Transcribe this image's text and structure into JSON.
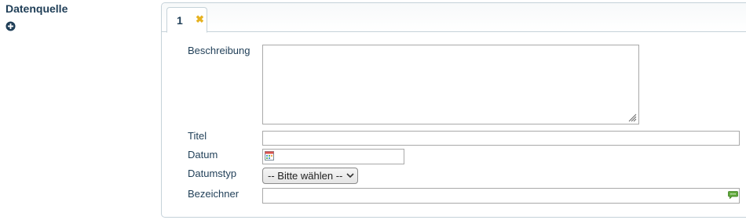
{
  "section": {
    "label": "Datenquelle",
    "add_icon": "plus-circle-icon"
  },
  "tabs": [
    {
      "label": "1",
      "close_icon": "close-x-icon",
      "close_glyph": "✖"
    }
  ],
  "form": {
    "beschreibung": {
      "label": "Beschreibung",
      "value": ""
    },
    "titel": {
      "label": "Titel",
      "value": ""
    },
    "datum": {
      "label": "Datum",
      "value": "",
      "icon": "calendar-icon"
    },
    "datumstyp": {
      "label": "Datumstyp",
      "selected": "-- Bitte wählen --"
    },
    "bezeichner": {
      "label": "Bezeichner",
      "value": "",
      "icon": "comment-icon"
    }
  },
  "colors": {
    "label": "#1f3e57",
    "close_icon": "#e6b220",
    "comment_icon": "#5fa83a"
  }
}
